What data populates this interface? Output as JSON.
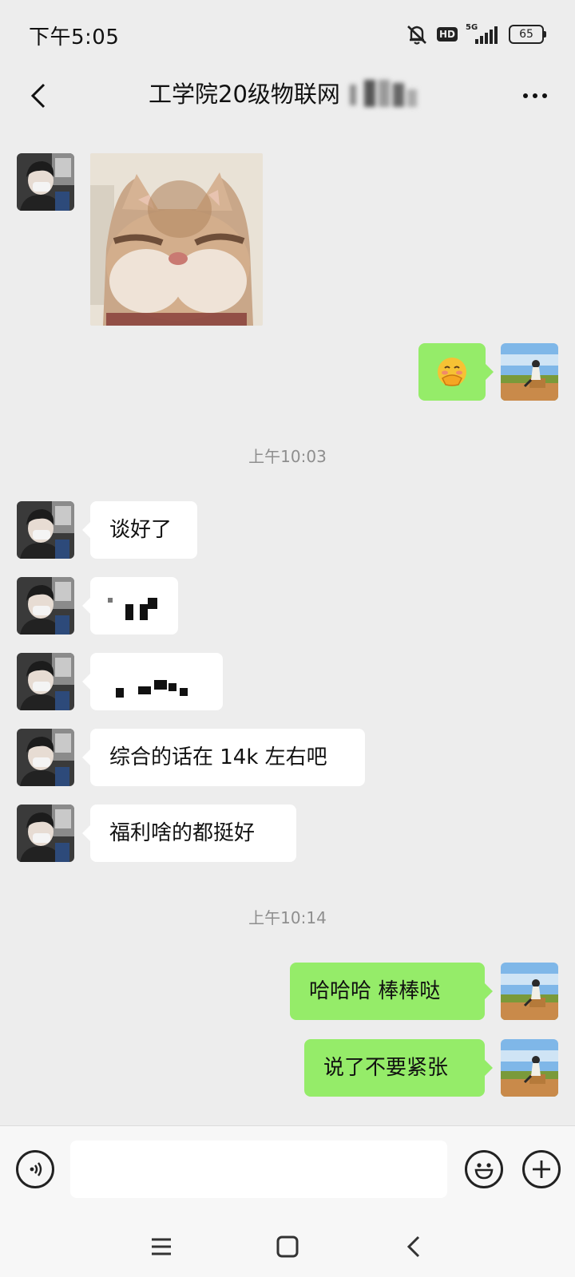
{
  "status_bar": {
    "time": "下午5:05",
    "network": "5G",
    "hd": "HD",
    "battery": "65"
  },
  "header": {
    "title": "工学院20级物联网"
  },
  "messages": [
    {
      "type": "sticker",
      "side": "left",
      "sticker": "cat-face-sticker"
    },
    {
      "type": "emoji",
      "side": "right",
      "emoji": "🤭"
    },
    {
      "type": "timestamp",
      "text": "上午10:03"
    },
    {
      "type": "text",
      "side": "left",
      "text": "谈好了"
    },
    {
      "type": "text",
      "side": "left",
      "text": "",
      "redacted": true
    },
    {
      "type": "text",
      "side": "left",
      "text": "",
      "redacted": true
    },
    {
      "type": "text",
      "side": "left",
      "text": "综合的话在 14k 左右吧"
    },
    {
      "type": "text",
      "side": "left",
      "text": "福利啥的都挺好"
    },
    {
      "type": "timestamp",
      "text": "上午10:14"
    },
    {
      "type": "text",
      "side": "right",
      "text": "哈哈哈 棒棒哒"
    },
    {
      "type": "text",
      "side": "right",
      "text": "说了不要紧张"
    }
  ],
  "input": {
    "value": "",
    "placeholder": ""
  },
  "icons": {
    "voice": "voice-icon",
    "emoji": "emoji-icon",
    "add": "plus-icon",
    "back": "back-arrow-icon",
    "more": "more-icon"
  },
  "colors": {
    "background": "#ededed",
    "outgoing_bubble": "#95ec69",
    "incoming_bubble": "#ffffff",
    "timestamp_text": "#8e8e8e"
  }
}
